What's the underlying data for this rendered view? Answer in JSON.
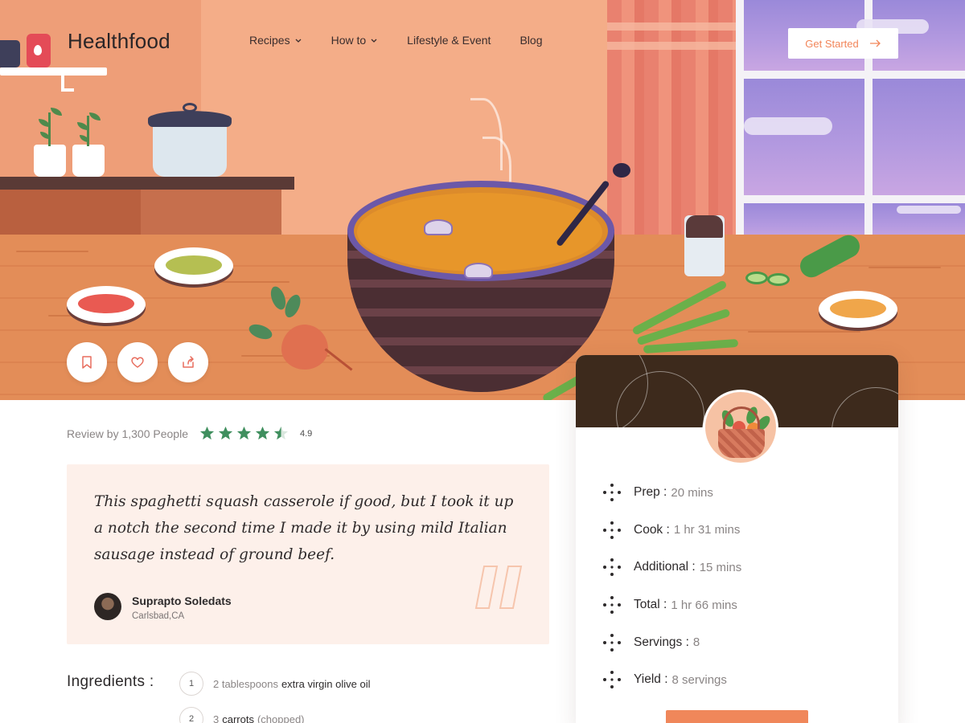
{
  "brand": {
    "name": "Healthfood"
  },
  "nav": {
    "items": [
      {
        "label": "Recipes",
        "has_dropdown": true
      },
      {
        "label": "How to",
        "has_dropdown": true
      },
      {
        "label": "Lifestyle & Event",
        "has_dropdown": false
      },
      {
        "label": "Blog",
        "has_dropdown": false
      }
    ],
    "cta_label": "Get Started"
  },
  "hero_actions": [
    {
      "icon": "bookmark-icon"
    },
    {
      "icon": "heart-icon"
    },
    {
      "icon": "share-icon"
    }
  ],
  "review": {
    "summary": "Review by 1,300 People",
    "rating": "4.9",
    "rating_value": 4.5,
    "star_color": "#3f8f5e",
    "quote": "This spaghetti squash casserole if good, but I took it up a notch the second time I made it by using mild Italian sausage instead of ground beef.",
    "author": {
      "name": "Suprapto Soledats",
      "location": "Carlsbad,CA"
    }
  },
  "ingredients": {
    "title": "Ingredients :",
    "items": [
      {
        "number": "1",
        "qty": "2 tablespoons",
        "name": "extra virgin olive oil",
        "note": ""
      },
      {
        "number": "2",
        "qty": "3",
        "name": "carrots",
        "note": "(chopped)"
      }
    ]
  },
  "recipe_stats": [
    {
      "label": "Prep :",
      "value": "20 mins"
    },
    {
      "label": "Cook :",
      "value": "1 hr 31 mins"
    },
    {
      "label": "Additional :",
      "value": "15 mins"
    },
    {
      "label": "Total :",
      "value": "1 hr 66 mins"
    },
    {
      "label": "Servings :",
      "value": "8"
    },
    {
      "label": "Yield :",
      "value": "8 servings"
    }
  ],
  "colors": {
    "accent": "#f0875a",
    "hero_bg": "#f2a882",
    "quote_bg": "#fdf0ea",
    "card_header": "#3d2a1c"
  }
}
